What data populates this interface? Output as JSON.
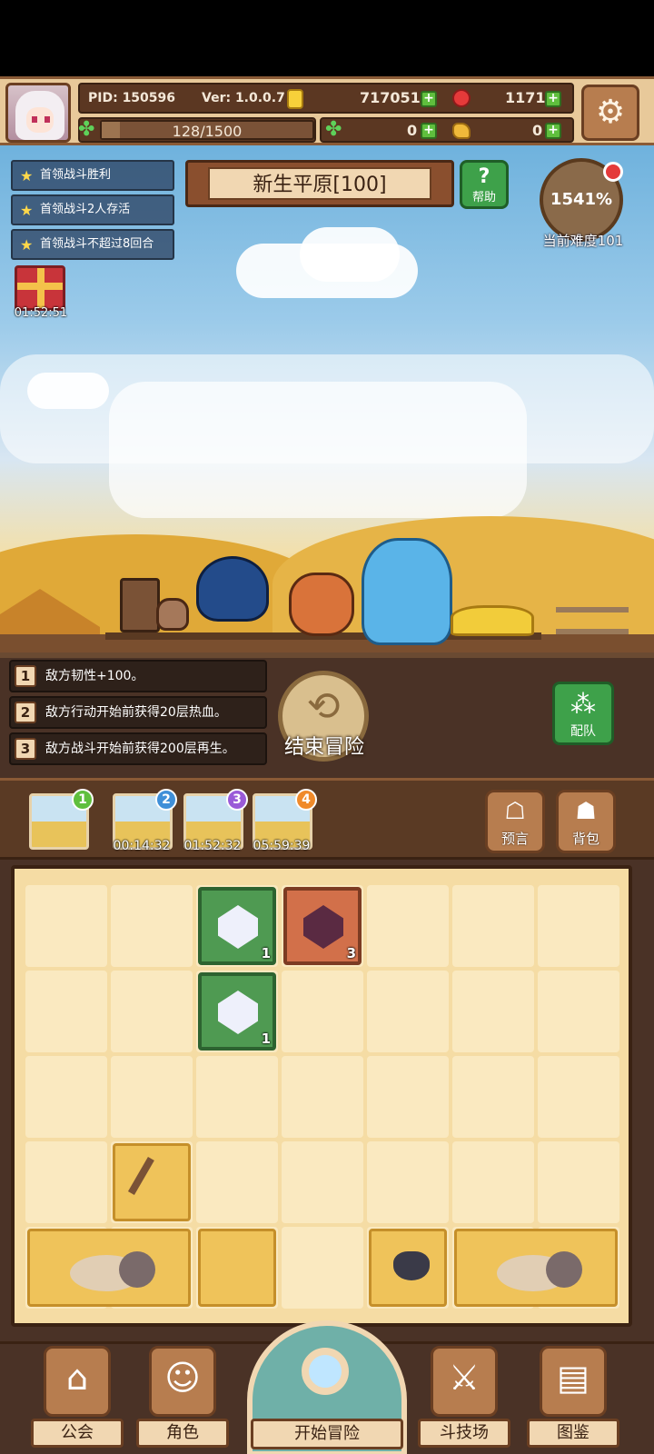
{
  "header": {
    "pid": "PID: 150596",
    "version": "Ver: 1.0.0.7",
    "gold": "717051",
    "ruby": "1171",
    "energy": "128/1500",
    "energy_fraction": 0.085,
    "clover": "0",
    "bread": "0",
    "settings_icon": "gear-icon"
  },
  "quests": [
    {
      "label": "首领战斗胜利"
    },
    {
      "label": "首领战斗2人存活"
    },
    {
      "label": "首领战斗不超过8回合"
    }
  ],
  "stage": {
    "name": "新生平原[100]",
    "help_label": "帮助",
    "difficulty_percent": "1541%",
    "difficulty_label": "当前难度101"
  },
  "gift": {
    "timer": "01:52:51"
  },
  "effects": [
    {
      "num": "1",
      "text": "敌方韧性+100。"
    },
    {
      "num": "2",
      "text": "敌方行动开始前获得20层热血。"
    },
    {
      "num": "3",
      "text": "敌方战斗开始前获得200层再生。"
    }
  ],
  "end_adventure_label": "结束冒险",
  "team_label": "配队",
  "cards": [
    {
      "badge": "1",
      "timer": "",
      "color": "#5fbf3d"
    },
    {
      "badge": "2",
      "timer": "00:14:32",
      "color": "#3f8fd8"
    },
    {
      "badge": "3",
      "timer": "01:52:32",
      "color": "#9a5ad8"
    },
    {
      "badge": "4",
      "timer": "05:59:39",
      "color": "#f08a2a"
    }
  ],
  "buttons": {
    "prophecy_label": "预言",
    "backpack_label": "背包"
  },
  "grid_items": [
    {
      "type": "white-crystal",
      "count": "1"
    },
    {
      "type": "dark-crystal",
      "count": "3"
    },
    {
      "type": "white-crystal",
      "count": "1"
    }
  ],
  "nav": {
    "guild": "公会",
    "character": "角色",
    "start": "开始冒险",
    "arena": "斗技场",
    "codex": "图鉴"
  }
}
